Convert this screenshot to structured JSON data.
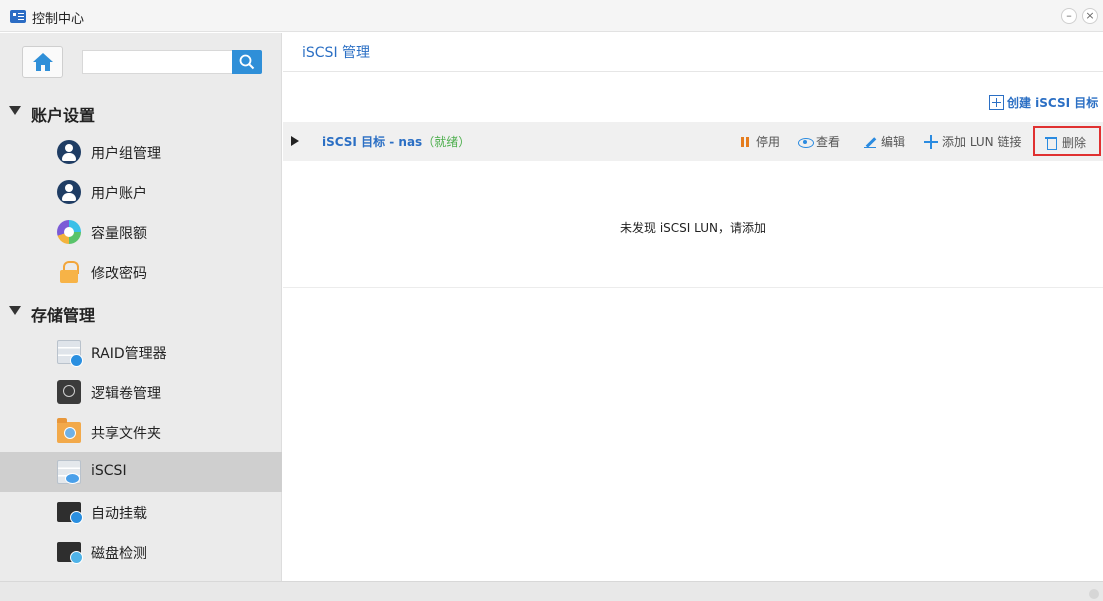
{
  "window": {
    "title": "控制中心",
    "minimize_label": "–",
    "close_label": "×"
  },
  "sidebar": {
    "search": {
      "placeholder": "",
      "value": ""
    },
    "groups": [
      {
        "label": "账户设置",
        "items": [
          {
            "label": "用户组管理",
            "icon": "user-group-icon"
          },
          {
            "label": "用户账户",
            "icon": "user-account-icon"
          },
          {
            "label": "容量限额",
            "icon": "quota-icon"
          },
          {
            "label": "修改密码",
            "icon": "lock-icon"
          }
        ]
      },
      {
        "label": "存储管理",
        "items": [
          {
            "label": "RAID管理器",
            "icon": "raid-icon"
          },
          {
            "label": "逻辑卷管理",
            "icon": "lvm-icon"
          },
          {
            "label": "共享文件夹",
            "icon": "shared-folder-icon"
          },
          {
            "label": "iSCSI",
            "icon": "iscsi-icon",
            "active": true
          },
          {
            "label": "自动挂载",
            "icon": "auto-mount-icon"
          },
          {
            "label": "磁盘检测",
            "icon": "disk-check-icon"
          }
        ]
      }
    ]
  },
  "main": {
    "title": "iSCSI 管理",
    "create_label": "创建 iSCSI 目标",
    "target": {
      "name": "iSCSI 目标 - nas",
      "status": "（就绪）",
      "actions": {
        "stop": "停用",
        "view": "查看",
        "edit": "编辑",
        "add_lun": "添加 LUN 链接",
        "delete": "删除"
      }
    },
    "empty_message": "未发现 iSCSI LUN，请添加"
  },
  "colors": {
    "accent": "#2b6fc4",
    "status_ready": "#4cae4c",
    "highlight_border": "#e03131",
    "stop_icon": "#e57c1d"
  }
}
